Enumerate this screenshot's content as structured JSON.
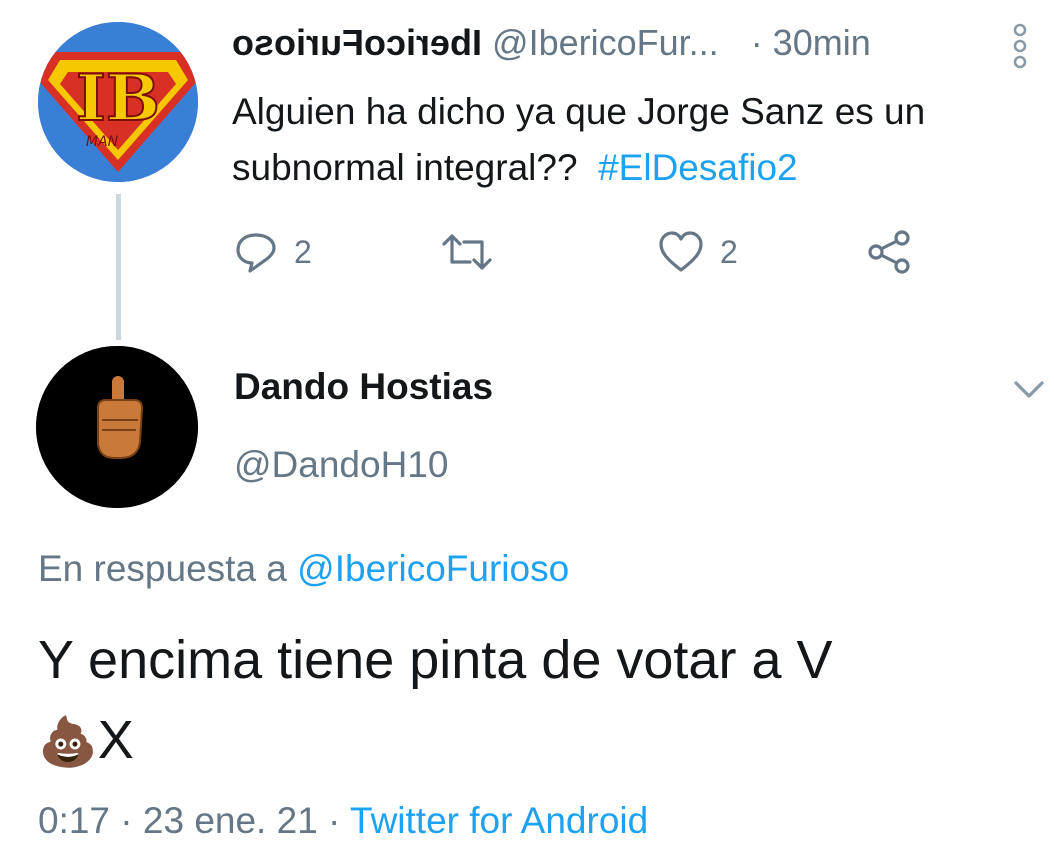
{
  "tweet1": {
    "display_name": "IbericoFurioso",
    "handle": "@IbericoFur...",
    "time": "· 30min",
    "text": "Alguien ha dicho ya que Jorge Sanz es un subnormal integral??",
    "hashtag": "#ElDesafio2",
    "avatar": {
      "text": "IB",
      "subtext": "MAN",
      "colors": {
        "bg": "#3a7fd6",
        "shield": "#d93025",
        "letters": "#f5c800"
      }
    },
    "actions": {
      "reply_count": "2",
      "retweet_count": "",
      "like_count": "2"
    }
  },
  "tweet2": {
    "display_name": "Dando Hostias",
    "handle": "@DandoH10",
    "reply_prefix": "En respuesta a",
    "reply_to": "@IbericoFurioso",
    "text_line1": "Y encima tiene pinta de votar a V",
    "text_line2_emoji": "💩",
    "text_line2": "X",
    "footer_time": "0:17 · 23 ene. 21 ·",
    "footer_source": "Twitter for Android"
  },
  "colors": {
    "accent": "#1da1f2",
    "muted": "#657786",
    "text": "#14171a",
    "divider": "#ccd6dd"
  }
}
